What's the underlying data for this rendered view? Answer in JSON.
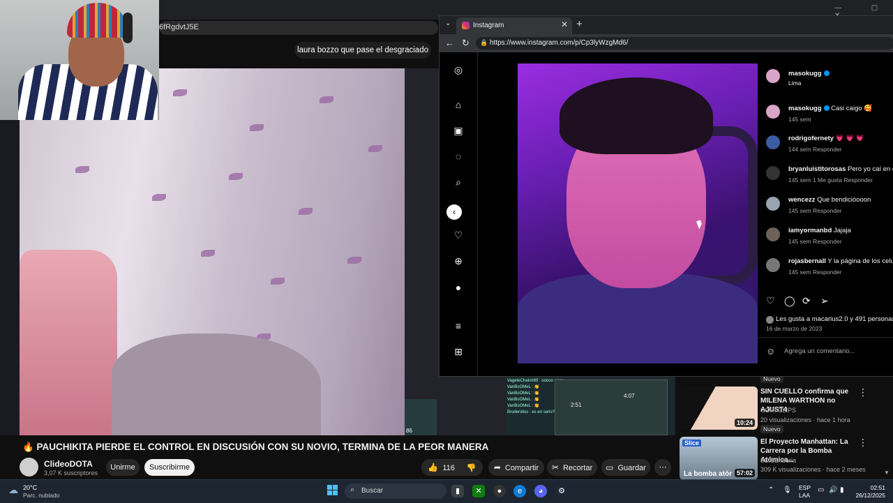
{
  "yt_browser": {
    "url_fragment": "6fRgdvtJ5E",
    "window_controls": "— ▢ ✕"
  },
  "stream": {
    "chat_bubble": "laura bozzo que pase el desgraciado",
    "game_chat_lines": [
      "VageteChakm69 : ooooo oooo",
      "VanBoOMeL : 👏",
      "VanBoOMeL : 👏",
      "VanBoOMeL : 👏",
      "VanBoOMeL : 👏",
      "Brodersitos : es en serio?, kjakjakja"
    ],
    "game_clock": "2:51",
    "game_clock2": "4:07",
    "game_hud_number": "86"
  },
  "video": {
    "title": "🔥 PAUCHIKITA PIERDE EL CONTROL EN DISCUSIÓN CON SU NOVIO, TERMINA DE LA PEOR MANERA",
    "channel_name": "ClideoDOTA",
    "subscribers": "3,07 K suscriptores",
    "join_label": "Unirme",
    "subscribe_label": "Suscribirme",
    "like_count": "116",
    "share_label": "Compartir",
    "clip_label": "Recortar",
    "save_label": "Guardar"
  },
  "suggestions": [
    {
      "badge_top": "Nuevo",
      "title": "SIN CUELLO confirma que MILENA WARTHON no AJUST4",
      "channel": "CORI CLIPS",
      "meta": "20 visualizaciones · hace 1 hora",
      "badge": "Nuevo",
      "duration": "10:24"
    },
    {
      "title": "El Proyecto Manhattan: La Carrera por la Bomba Atómica...",
      "channel": "SLICE Iberia",
      "meta": "309 K visualizaciones · hace 2 meses",
      "duration": "57:02",
      "thumb_text": "La bomba atór",
      "thumb_brand": "Slice"
    }
  ],
  "instagram": {
    "tab_title": "Instagram",
    "url": "https://www.instagram.com/p/Cp3lyWzgMd6/",
    "owner": {
      "username": "masokugg",
      "location": "Lima"
    },
    "comments": [
      {
        "user": "masokugg",
        "verified": true,
        "text": "Casi caigo 🥰",
        "meta": "145 sem"
      },
      {
        "user": "rodrigofernety",
        "verified": false,
        "text": "💗 💗 💗",
        "meta": "144 sem   Responder"
      },
      {
        "user": "bryanluistitorosas",
        "verified": false,
        "text": "Pero yo caí en ésa",
        "meta": "145 sem   1 Me gusta   Responder"
      },
      {
        "user": "wencezz",
        "verified": false,
        "text": "Que bendicióooon",
        "meta": "145 sem   Responder"
      },
      {
        "user": "iamyormanbd",
        "verified": false,
        "text": "Jajaja",
        "meta": "145 sem   Responder"
      },
      {
        "user": "rojasbernall",
        "verified": false,
        "text": "Y la página de los celula",
        "meta": "145 sem   Responder"
      }
    ],
    "likes_text": "Les gusta a macarius2.0 y 491 personas m",
    "date": "16 de marzo de 2023",
    "comment_placeholder": "Agrega un comentario..."
  },
  "taskbar": {
    "temperature": "20°C",
    "weather": "Parc. nublado",
    "search_label": "Buscar",
    "lang1": "ESP",
    "lang2": "LAA",
    "time": "02:51",
    "date": "26/12/2025"
  },
  "colors": {
    "youtube_bg": "#0f0f0f",
    "instagram_verified": "#0095f6",
    "taskbar": "#1c2530",
    "windows_accent": "#4cc2ff"
  }
}
